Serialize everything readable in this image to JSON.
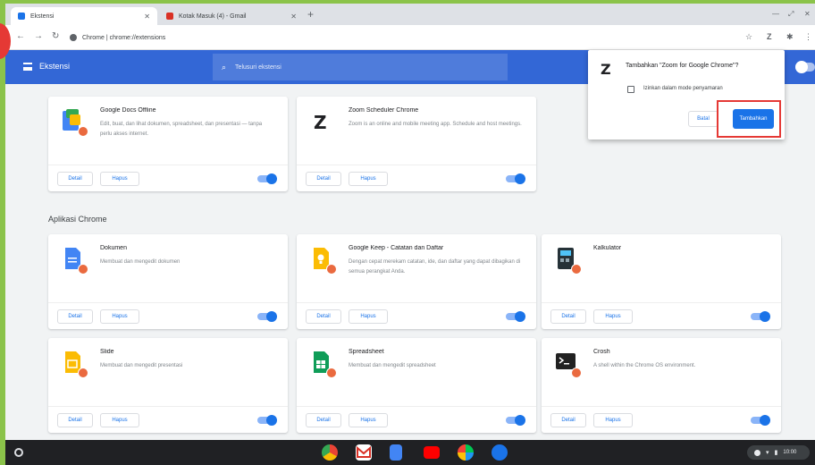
{
  "tabs": [
    {
      "title": "Ekstensi",
      "active": true,
      "favicon_color": "#1a73e8"
    },
    {
      "title": "Kotak Masuk (4) - Gmail",
      "active": false,
      "favicon_color": "#d93025"
    }
  ],
  "omnibox": {
    "text": "Chrome  |  chrome://extensions"
  },
  "header": {
    "title": "Ekstensi",
    "search_placeholder": "Telusuri ekstensi"
  },
  "sections": [
    {
      "title": "",
      "cards": [
        {
          "name": "Google Docs Offline",
          "description": "Edit, buat, dan lihat dokumen, spreadsheet, dan presentasi — tanpa perlu akses internet.",
          "icon": "docs-offline-icon",
          "detail_label": "Detail",
          "remove_label": "Hapus"
        },
        {
          "name": "Zoom Scheduler Chrome",
          "description": "Zoom is an online and mobile meeting app. Schedule and host meetings.",
          "icon": "zoom-scheduler-icon",
          "detail_label": "Detail",
          "remove_label": "Hapus"
        }
      ]
    },
    {
      "title": "Aplikasi Chrome",
      "cards": [
        {
          "name": "Dokumen",
          "description": "Membuat dan mengedit dokumen",
          "icon": "docs-icon",
          "detail_label": "Detail",
          "remove_label": "Hapus"
        },
        {
          "name": "Google Keep - Catatan dan Daftar",
          "description": "Dengan cepat merekam catatan, ide, dan daftar yang dapat dibagikan di semua perangkat Anda.",
          "icon": "keep-icon",
          "detail_label": "Detail",
          "remove_label": "Hapus"
        },
        {
          "name": "Kalkulator",
          "description": "",
          "icon": "calculator-icon",
          "detail_label": "Detail",
          "remove_label": "Hapus"
        },
        {
          "name": "Slide",
          "description": "Membuat dan mengedit presentasi",
          "icon": "slides-icon",
          "detail_label": "Detail",
          "remove_label": "Hapus"
        },
        {
          "name": "Spreadsheet",
          "description": "Membuat dan mengedit spreadsheet",
          "icon": "sheets-icon",
          "detail_label": "Detail",
          "remove_label": "Hapus"
        },
        {
          "name": "Crosh",
          "description": "A shell within the Chrome OS environment.",
          "icon": "terminal-icon",
          "detail_label": "Detail",
          "remove_label": "Hapus"
        }
      ]
    }
  ],
  "popup": {
    "title": "Tambahkan \"Zoom for Google Chrome\"?",
    "checkbox_label": "Izinkan dalam mode penyamaran",
    "cancel_label": "Batal",
    "confirm_label": "Tambahkan"
  },
  "shelf": {
    "apps": [
      "chrome-icon",
      "gmail-icon",
      "docs-icon",
      "youtube-icon",
      "play-store-icon",
      "files-icon"
    ],
    "time": "10:00"
  },
  "colors": {
    "accent": "#1a73e8",
    "header": "#3367d6",
    "highlight": "#e53935"
  }
}
